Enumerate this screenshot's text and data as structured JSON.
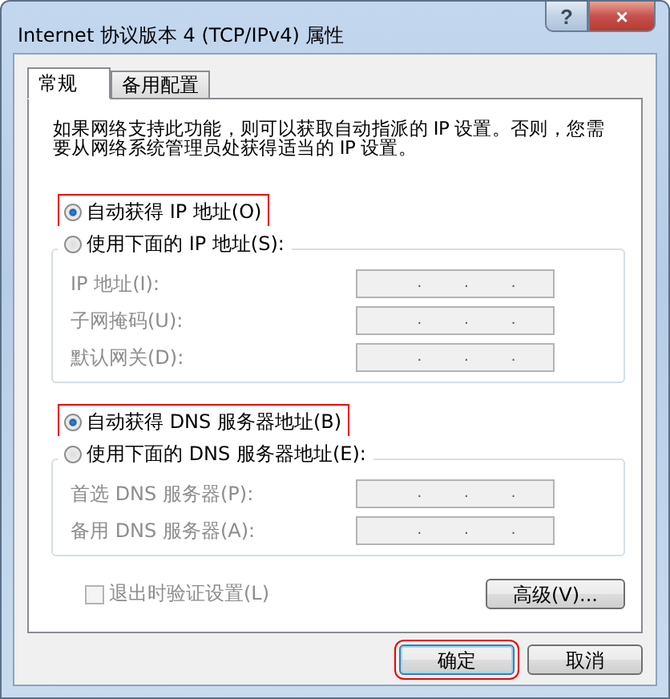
{
  "window": {
    "title": "Internet 协议版本 4 (TCP/IPv4) 属性",
    "help_button": "?",
    "close_button": "×"
  },
  "tabs": [
    {
      "label": "常规",
      "selected": true
    },
    {
      "label": "备用配置",
      "selected": false
    }
  ],
  "description": "如果网络支持此功能，则可以获取自动指派的 IP 设置。否则，您需要从网络系统管理员处获得适当的 IP 设置。",
  "sections": [
    {
      "auto": {
        "label": "自动获得 IP 地址(O)",
        "selected": true,
        "highlighted": true
      },
      "manual": {
        "label": "使用下面的 IP 地址(S):",
        "selected": false
      },
      "disabled": true,
      "fields": [
        {
          "label": "IP 地址(I):",
          "dots": [
            ".",
            ".",
            "."
          ]
        },
        {
          "label": "子网掩码(U):",
          "dots": [
            ".",
            ".",
            "."
          ]
        },
        {
          "label": "默认网关(D):",
          "dots": [
            ".",
            ".",
            "."
          ]
        }
      ]
    },
    {
      "auto": {
        "label": "自动获得 DNS 服务器地址(B)",
        "selected": true,
        "highlighted": true
      },
      "manual": {
        "label": "使用下面的 DNS 服务器地址(E):",
        "selected": false
      },
      "disabled": true,
      "fields": [
        {
          "label": "首选 DNS 服务器(P):",
          "dots": [
            ".",
            ".",
            "."
          ]
        },
        {
          "label": "备用 DNS 服务器(A):",
          "dots": [
            ".",
            ".",
            "."
          ]
        }
      ]
    }
  ],
  "validate_checkbox": {
    "label": "退出时验证设置(L)",
    "checked": false,
    "disabled": true
  },
  "advanced_button": "高级(V)...",
  "buttons": [
    {
      "label": "确定",
      "highlighted": true
    },
    {
      "label": "取消",
      "highlighted": false
    }
  ]
}
